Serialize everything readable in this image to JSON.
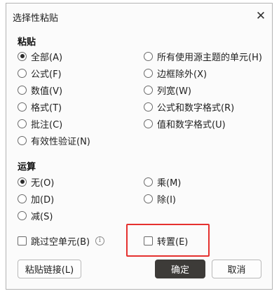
{
  "dialog": {
    "title": "选择性粘贴",
    "close_icon": "close-icon"
  },
  "paste_section": {
    "title": "粘贴",
    "options": [
      {
        "label": "全部(A)",
        "checked": true
      },
      {
        "label": "所有使用源主题的单元(H)",
        "checked": false
      },
      {
        "label": "公式(F)",
        "checked": false
      },
      {
        "label": "边框除外(X)",
        "checked": false
      },
      {
        "label": "数值(V)",
        "checked": false
      },
      {
        "label": "列宽(W)",
        "checked": false
      },
      {
        "label": "格式(T)",
        "checked": false
      },
      {
        "label": "公式和数字格式(R)",
        "checked": false
      },
      {
        "label": "批注(C)",
        "checked": false
      },
      {
        "label": "值和数字格式(U)",
        "checked": false
      },
      {
        "label": "有效性验证(N)",
        "checked": false
      }
    ]
  },
  "operation_section": {
    "title": "运算",
    "options": [
      {
        "label": "无(O)",
        "checked": true
      },
      {
        "label": "乘(M)",
        "checked": false
      },
      {
        "label": "加(D)",
        "checked": false
      },
      {
        "label": "除(I)",
        "checked": false
      },
      {
        "label": "减(S)",
        "checked": false
      }
    ]
  },
  "skip_blanks": {
    "label": "跳过空单元(B)",
    "checked": false,
    "info_icon": "info-icon"
  },
  "transpose": {
    "label": "转置(E)",
    "checked": false
  },
  "buttons": {
    "paste_link": "粘贴链接(L)",
    "ok": "确定",
    "cancel": "取消"
  },
  "colors": {
    "highlight": "#e5312f",
    "primary_button": "#3d3b38"
  }
}
